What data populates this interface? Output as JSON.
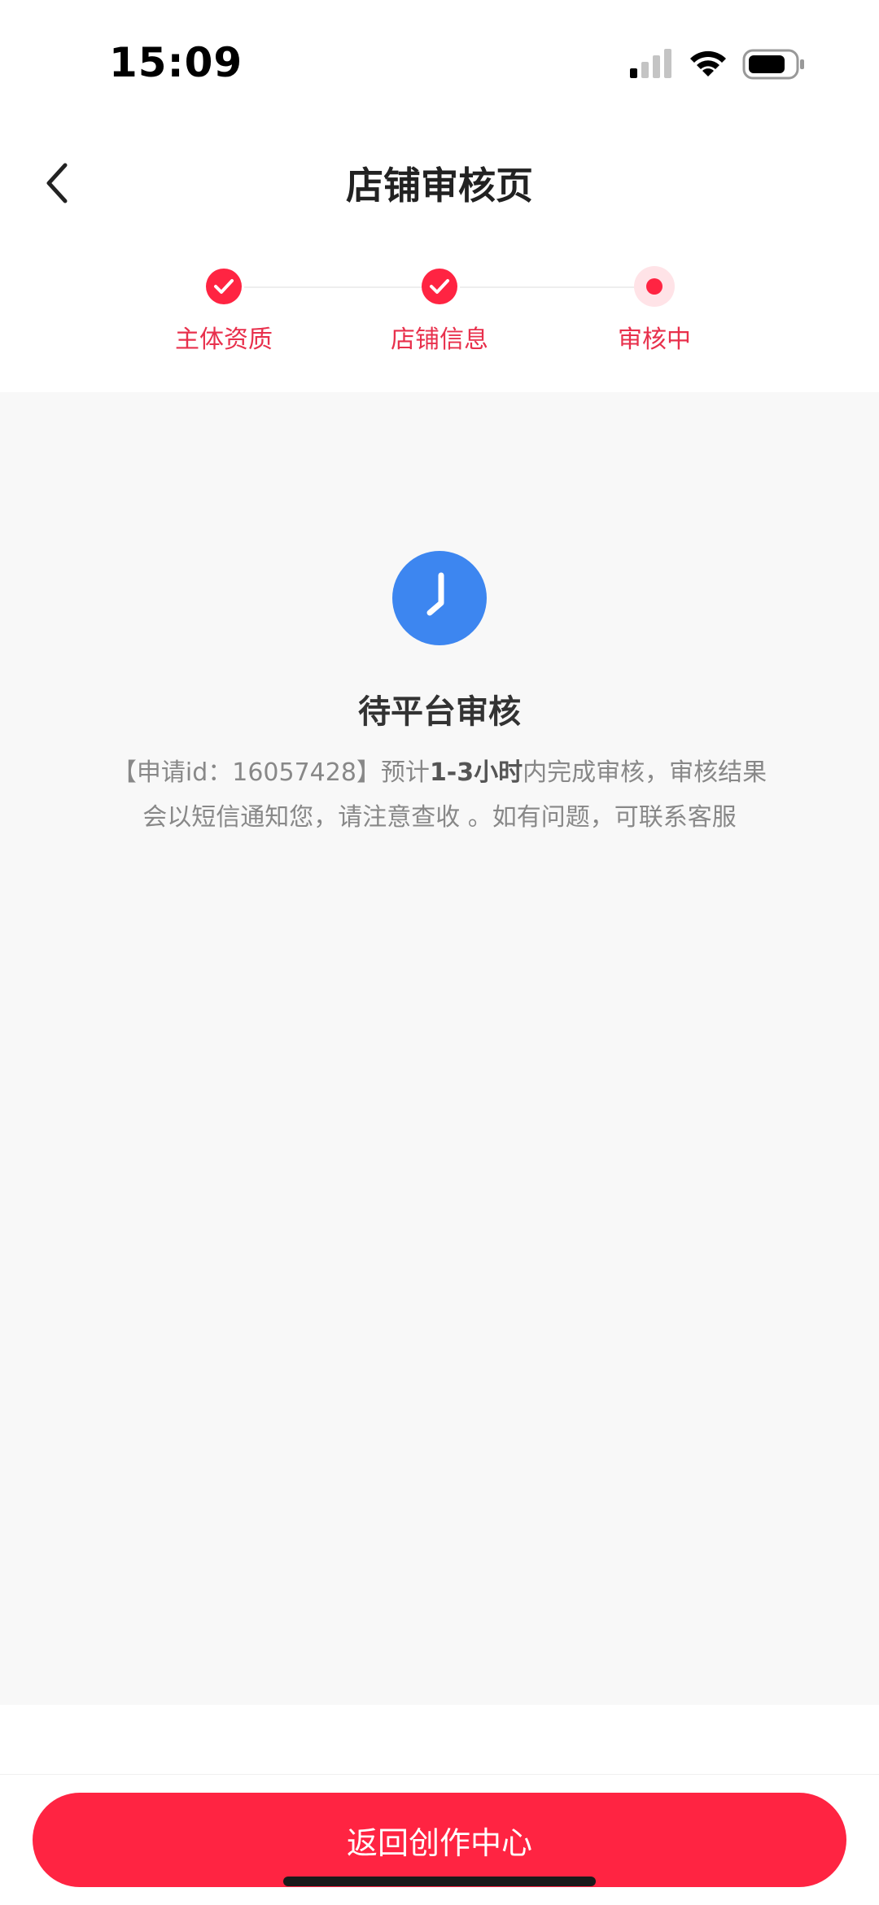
{
  "status_bar": {
    "time": "15:09"
  },
  "nav": {
    "title": "店铺审核页"
  },
  "steps": [
    {
      "label": "主体资质",
      "state": "done"
    },
    {
      "label": "店铺信息",
      "state": "done"
    },
    {
      "label": "审核中",
      "state": "current"
    }
  ],
  "status": {
    "title": "待平台审核",
    "desc_prefix": "【申请id：16057428】预计",
    "desc_bold": "1-3小时",
    "desc_suffix": "内完成审核，审核结果会以短信通知您，请注意查收 。如有问题，可联系客服"
  },
  "footer": {
    "button_label": "返回创作中心"
  },
  "colors": {
    "accent": "#ff2442",
    "clock": "#3d86f0",
    "background": "#f8f8f8"
  }
}
